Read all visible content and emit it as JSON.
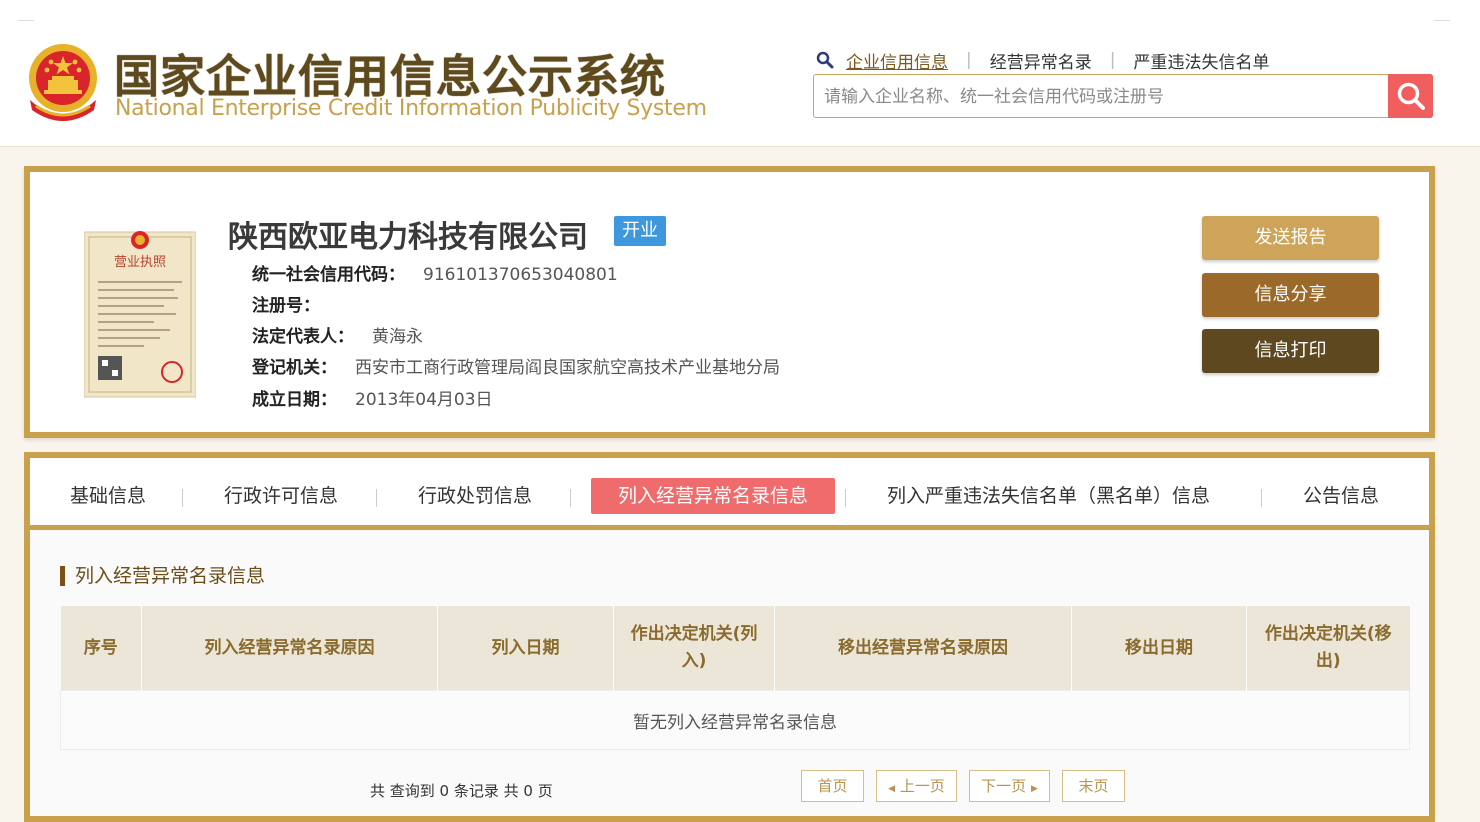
{
  "header": {
    "title_cn": "国家企业信用信息公示系统",
    "title_en": "National Enterprise Credit Information Publicity System",
    "nav": [
      "企业信用信息",
      "经营异常名录",
      "严重违法失信名单"
    ],
    "search_placeholder": "请输入企业名称、统一社会信用代码或注册号",
    "icons": {
      "search": "search-icon",
      "nav": "magnifier-icon",
      "emblem": "national-emblem-icon"
    }
  },
  "company": {
    "name": "陕西欧亚电力科技有限公司",
    "status": "开业",
    "fields": [
      {
        "label": "统一社会信用代码：",
        "value": "916101370653040801"
      },
      {
        "label": "注册号：",
        "value": ""
      },
      {
        "label": "法定代表人：",
        "value": "黄海永"
      },
      {
        "label": "登记机关：",
        "value": "西安市工商行政管理局阎良国家航空高技术产业基地分局"
      },
      {
        "label": "成立日期：",
        "value": "2013年04月03日"
      }
    ],
    "actions": [
      "发送报告",
      "信息分享",
      "信息打印"
    ],
    "license_title": "营业执照"
  },
  "tabs": [
    "基础信息",
    "行政许可信息",
    "行政处罚信息",
    "列入经营异常名录信息",
    "列入严重违法失信名单（黑名单）信息",
    "公告信息"
  ],
  "active_tab": "列入经营异常名录信息",
  "section": {
    "title": "列入经营异常名录信息",
    "columns": [
      "序号",
      "列入经营异常名录原因",
      "列入日期",
      "作出决定机关(列入)",
      "移出经营异常名录原因",
      "移出日期",
      "作出决定机关(移出)"
    ],
    "empty_text": "暂无列入经营异常名录信息",
    "summary": "共 查询到 0 条记录 共 0 页",
    "pager": [
      "首页",
      "上一页",
      "下一页",
      "末页"
    ]
  },
  "colors": {
    "gold": "#c9a04c",
    "brown_title": "#5e4a1c",
    "active_tab": "#f06b6b",
    "badge": "#3f98de",
    "btn_send": "#cda45a",
    "btn_share": "#9b6a2b",
    "btn_print": "#5d4820"
  }
}
